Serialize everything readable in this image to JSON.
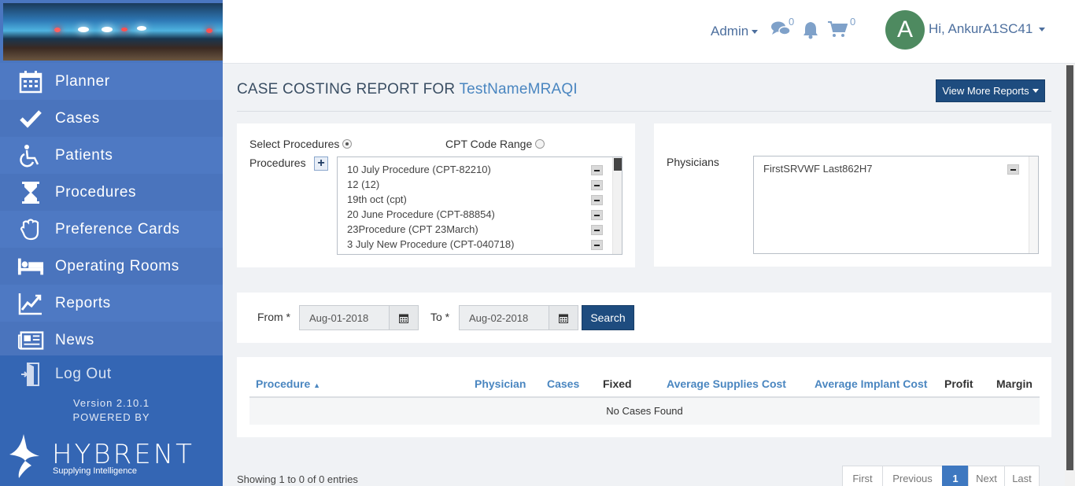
{
  "sidebar": {
    "items": [
      {
        "label": "Planner",
        "icon": "calendar-icon"
      },
      {
        "label": "Cases",
        "icon": "checkmark-icon"
      },
      {
        "label": "Patients",
        "icon": "wheelchair-icon"
      },
      {
        "label": "Procedures",
        "icon": "hourglass-icon"
      },
      {
        "label": "Preference Cards",
        "icon": "glove-icon"
      },
      {
        "label": "Operating Rooms",
        "icon": "bed-icon"
      },
      {
        "label": "Reports",
        "icon": "chart-line-icon"
      },
      {
        "label": "News",
        "icon": "newspaper-icon"
      }
    ],
    "logout": "Log Out",
    "version": "Version 2.10.1",
    "powered_by": "POWERED BY",
    "brand": "HYBRENT",
    "tagline": "Supplying Intelligence"
  },
  "header": {
    "admin_label": "Admin",
    "messages_count": "0",
    "cart_count": "0",
    "avatar_letter": "A",
    "greeting": "Hi, AnkurA1SC41"
  },
  "page": {
    "title_prefix": "CASE COSTING REPORT FOR",
    "title_name": "TestNameMRAQI",
    "more_reports": "View More Reports"
  },
  "filters": {
    "select_procedures": "Select Procedures",
    "cpt_code_range": "CPT Code Range",
    "procedures_label": "Procedures",
    "procedures": [
      "10 July Procedure (CPT-82210)",
      "12 (12)",
      "19th oct (cpt)",
      "20 June Procedure (CPT-88854)",
      "23Procedure (CPT 23March)",
      "3 July New Procedure (CPT-040718)"
    ],
    "physicians_label": "Physicians",
    "physicians": [
      "FirstSRVWF Last862H7"
    ]
  },
  "dates": {
    "from_label": "From *",
    "from_value": "Aug-01-2018",
    "to_label": "To *",
    "to_value": "Aug-02-2018",
    "search_label": "Search"
  },
  "table": {
    "columns": [
      "Procedure",
      "Physician",
      "Cases",
      "Fixed",
      "Average Supplies Cost",
      "Average Implant Cost",
      "Profit",
      "Margin"
    ],
    "empty_message": "No Cases Found"
  },
  "footer": {
    "showing": "Showing 1 to 0 of 0 entries",
    "pages": [
      "First",
      "Previous",
      "1",
      "Next",
      "Last"
    ]
  },
  "colors": {
    "sidebar": "#4a76c0",
    "accent": "#1e4c7f",
    "link": "#4a86c0"
  }
}
